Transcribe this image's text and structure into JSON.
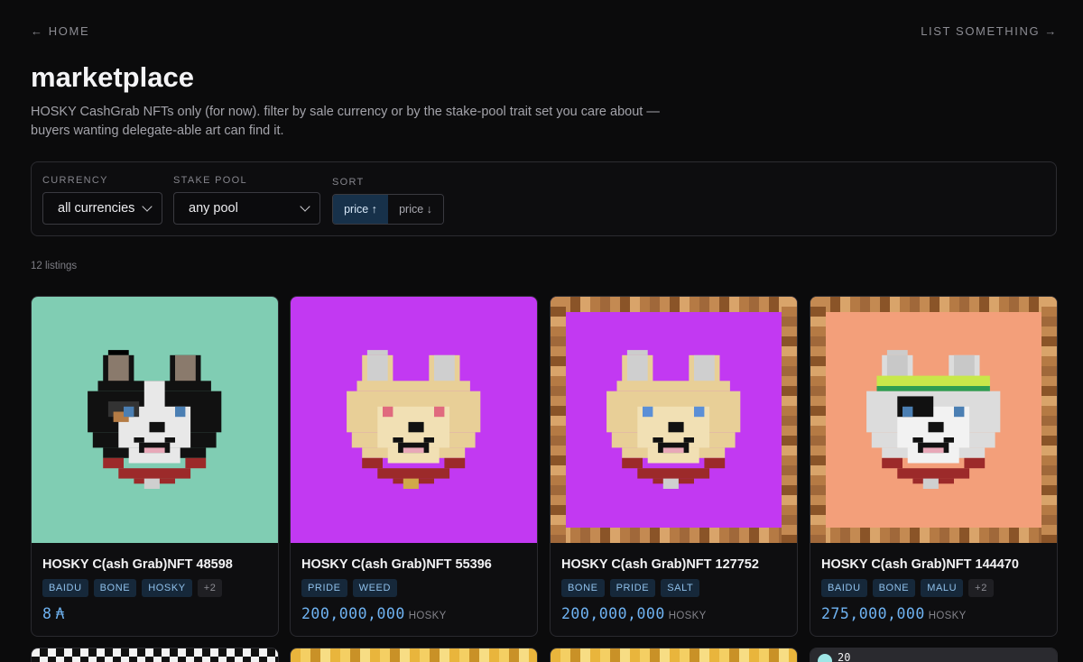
{
  "nav": {
    "home": "← HOME",
    "list": "LIST SOMETHING →"
  },
  "page": {
    "title": "marketplace",
    "description": "HOSKY CashGrab NFTs only (for now). filter by sale currency or by the stake-pool trait set you care about — buyers wanting delegate-able art can find it."
  },
  "filters": {
    "currency_label": "CURRENCY",
    "currency_value": "all currencies",
    "pool_label": "STAKE POOL",
    "pool_value": "any pool",
    "sort_label": "SORT",
    "sort_asc": "price ↑",
    "sort_desc": "price ↓",
    "sort_active": "asc"
  },
  "listing_count": "12 listings",
  "listings": [
    {
      "title": "HOSKY C(ash Grab)NFT 48598",
      "tags": [
        "BAIDU",
        "BONE",
        "HOSKY",
        "+2"
      ],
      "price": "8",
      "unit": "₳",
      "bg": "#80cdb3",
      "frame": "none",
      "dog": "husky-black"
    },
    {
      "title": "HOSKY C(ash Grab)NFT 55396",
      "tags": [
        "PRIDE",
        "WEED"
      ],
      "price": "200,000,000",
      "unit": "HOSKY",
      "bg": "#c239f2",
      "frame": "none",
      "dog": "tan-red-eyes"
    },
    {
      "title": "HOSKY C(ash Grab)NFT 127752",
      "tags": [
        "BONE",
        "PRIDE",
        "SALT"
      ],
      "price": "200,000,000",
      "unit": "HOSKY",
      "bg": "#c239f2",
      "frame": "wood",
      "dog": "tan-blue-eyes"
    },
    {
      "title": "HOSKY C(ash Grab)NFT 144470",
      "tags": [
        "BAIDU",
        "BONE",
        "MALU",
        "+2"
      ],
      "price": "275,000,000",
      "unit": "HOSKY",
      "bg": "#f39f7a",
      "frame": "wood",
      "dog": "white-patch"
    }
  ],
  "next_row": [
    {
      "style": "checker"
    },
    {
      "style": "gold"
    },
    {
      "style": "gold"
    },
    {
      "style": "badge",
      "badge": "20"
    }
  ],
  "colors": {
    "accent": "#6fb3f2",
    "tag_bg": "#16283a",
    "sort_active_bg": "#17314a"
  }
}
